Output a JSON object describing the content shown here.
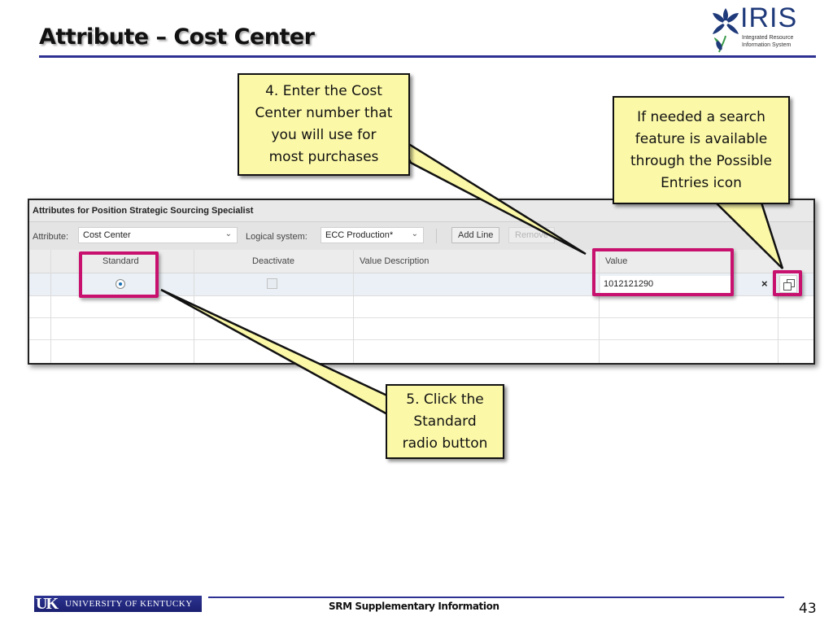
{
  "slide": {
    "title": "Attribute – Cost Center",
    "footer_text": "SRM Supplementary Information",
    "page_number": "43"
  },
  "logos": {
    "iris_word": "IRIS",
    "iris_subtitle_line1": "Integrated Resource",
    "iris_subtitle_line2": "Information System",
    "uk_mark": "UK",
    "uk_name": "UNIVERSITY OF KENTUCKY"
  },
  "sap": {
    "panel_title": "Attributes for Position Strategic Sourcing Specialist",
    "attribute_label": "Attribute:",
    "attribute_value": "Cost Center",
    "logical_system_label": "Logical system:",
    "logical_system_value": "ECC Production*",
    "add_line_label": "Add Line",
    "remove_label": "Remove",
    "columns": [
      "Standard",
      "Deactivate",
      "Value Description",
      "Value"
    ],
    "rows": [
      {
        "standard_selected": true,
        "deactivate_checked": false,
        "value_description": "",
        "value": "1012121290"
      }
    ],
    "clear_icon": "×"
  },
  "callouts": {
    "step4": [
      "4. Enter the Cost",
      "Center number that",
      "you will use for",
      "most purchases"
    ],
    "search_tip": [
      "If needed a search",
      "feature is available",
      "through the Possible",
      "Entries icon"
    ],
    "step5": [
      "5. Click the",
      "Standard",
      "radio button"
    ]
  },
  "colors": {
    "highlight": "#c8106e",
    "callout_fill": "#fbf8a8",
    "rule_blue": "#2e3192"
  }
}
